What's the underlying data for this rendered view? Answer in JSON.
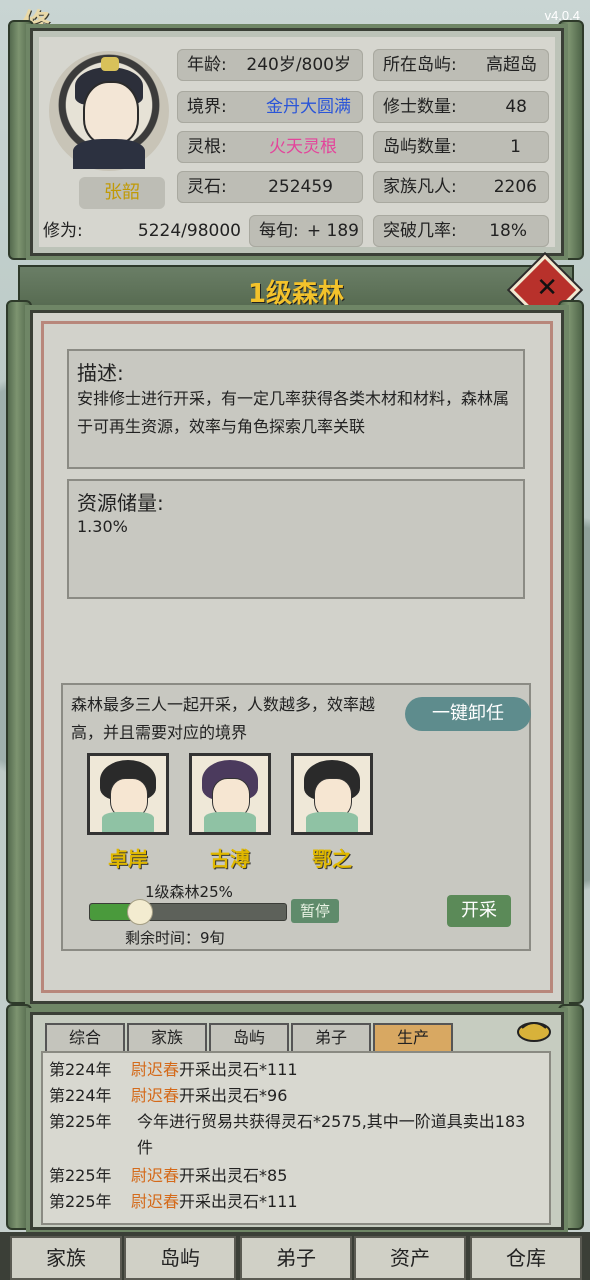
{
  "app": {
    "title_glyph": "修",
    "version": "v4.0.4"
  },
  "profile": {
    "name": "张韶",
    "age": {
      "label": "年龄:",
      "value": "240岁/800岁"
    },
    "island": {
      "label": "所在岛屿:",
      "value": "高超岛"
    },
    "realm": {
      "label": "境界:",
      "value": "金丹大圆满",
      "color": "#2a55d8"
    },
    "cultivators": {
      "label": "修士数量:",
      "value": "48"
    },
    "root": {
      "label": "灵根:",
      "value": "火天灵根",
      "color": "#e3459b"
    },
    "islands": {
      "label": "岛屿数量:",
      "value": "1"
    },
    "stones": {
      "label": "灵石:",
      "value": "252459"
    },
    "mortals": {
      "label": "家族凡人:",
      "value": "2206"
    },
    "cultivation": {
      "label": "修为:",
      "value": "5224/98000"
    },
    "per_xun": {
      "label": "每旬:",
      "value": "+ 189"
    },
    "breakthrough": {
      "label": "突破几率:",
      "value": "18%"
    }
  },
  "dialog": {
    "title": "1级森林",
    "close_icon": "close-x-icon",
    "desc_heading": "描述:",
    "desc_text": "安排修士进行开采，有一定几率获得各类木材和材料，森林属于可再生资源，效率与角色探索几率关联",
    "reserve_heading": "资源储量:",
    "reserve_value": "1.30%",
    "work_text": "森林最多三人一起开采，人数越多，效率越高，并且需要对应的境界",
    "unassign_label": "一键卸任",
    "disciples": [
      "卓岸",
      "古溥",
      "鄂之"
    ],
    "progress_label": "1级森林25%",
    "progress": 0.25,
    "pause_label": "暂停",
    "start_label": "开采",
    "remaining": "剩余时间：9旬"
  },
  "log": {
    "tabs": [
      "综合",
      "家族",
      "岛屿",
      "弟子",
      "生产"
    ],
    "active_tab": "生产",
    "entries": [
      {
        "year": "第224年",
        "name": "尉迟春",
        "text": "开采出灵石*111"
      },
      {
        "year": "第224年",
        "name": "尉迟春",
        "text": "开采出灵石*96"
      },
      {
        "year": "第225年",
        "name": "",
        "text": "今年进行贸易共获得灵石*2575,其中一阶道具卖出183件"
      },
      {
        "year": "第225年",
        "name": "尉迟春",
        "text": "开采出灵石*85"
      },
      {
        "year": "第225年",
        "name": "尉迟春",
        "text": "开采出灵石*111"
      }
    ]
  },
  "bottom_nav": [
    "家族",
    "岛屿",
    "弟子",
    "资产",
    "仓库"
  ]
}
